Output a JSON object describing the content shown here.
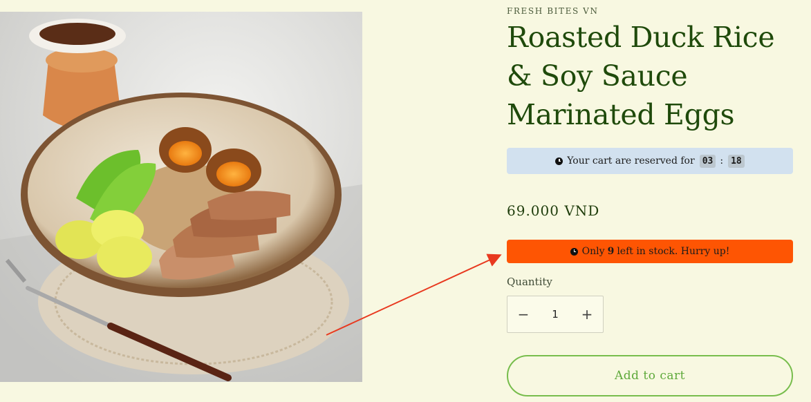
{
  "product": {
    "vendor": "FRESH BITES VN",
    "title": "Roasted Duck Rice & Soy Sauce Marinated Eggs",
    "price": "69.000 VND",
    "image_alt": "Bowl of roasted duck rice with marinated eggs, bok choy and pickled radish"
  },
  "reservation": {
    "prefix": "Your cart are reserved for",
    "minutes": "03",
    "separator": ":",
    "seconds": "18",
    "icon": "clock-icon"
  },
  "stock": {
    "prefix": "Only",
    "count": "9",
    "suffix": "left in stock. Hurry up!",
    "icon": "clock-icon"
  },
  "quantity": {
    "label": "Quantity",
    "value": "1",
    "decrement": "−",
    "increment": "+"
  },
  "cart": {
    "add_label": "Add to cart"
  },
  "colors": {
    "background": "#f8f8e1",
    "title": "#1f4a0b",
    "reserve_bar": "#d2e1ef",
    "stock_bar": "#fe5503",
    "add_button_border": "#77bd4c",
    "annotation_arrow": "#e8391f"
  }
}
